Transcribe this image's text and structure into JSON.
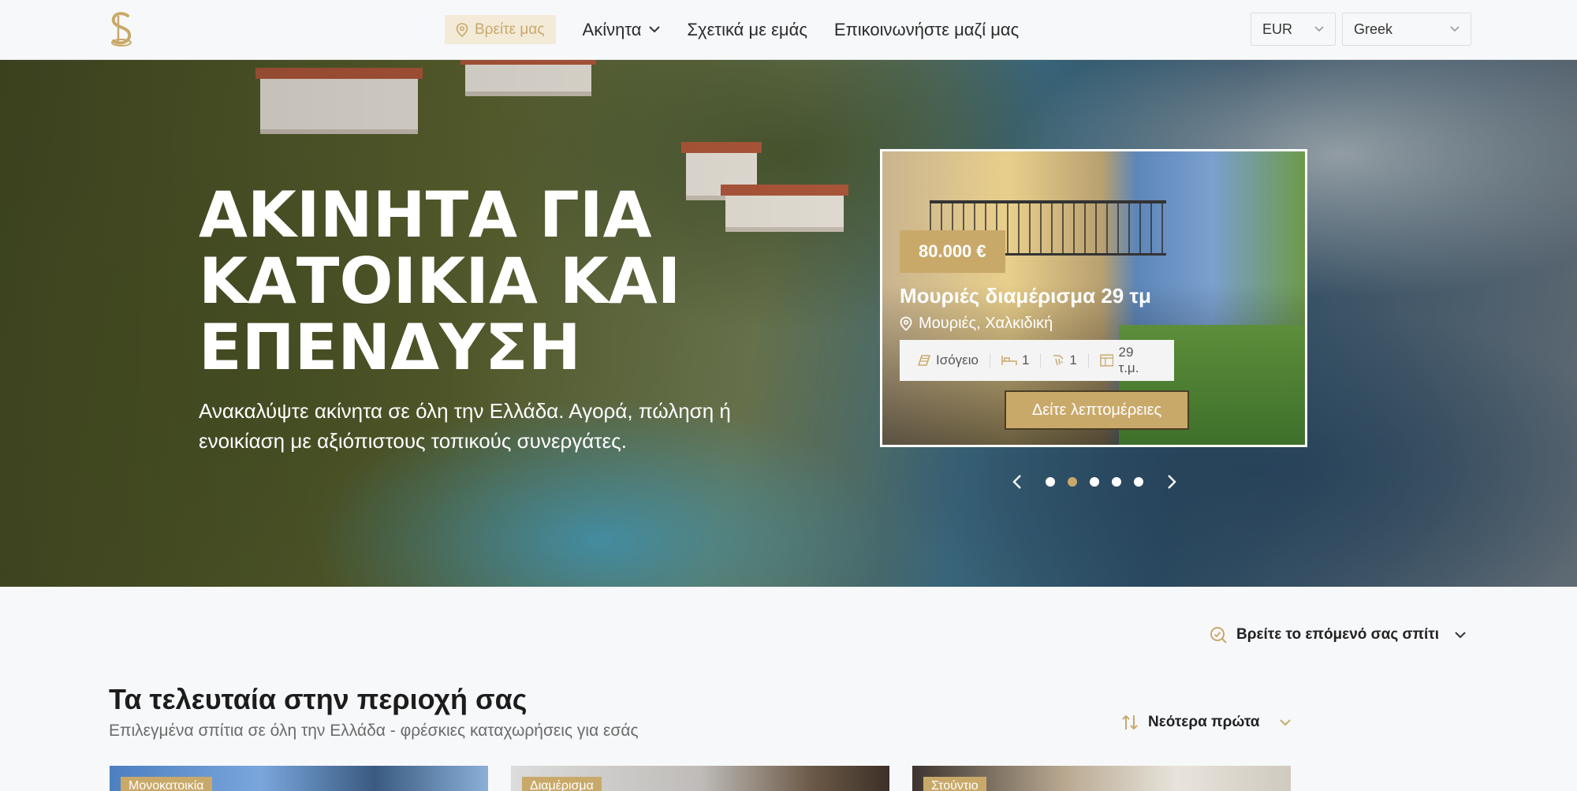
{
  "header": {
    "nav": {
      "find_us": "Βρείτε μας",
      "properties": "Ακίνητα",
      "about": "Σχετικά με εμάς",
      "contact": "Επικοινωνήστε μαζί μας"
    },
    "currency": "EUR",
    "language": "Greek"
  },
  "hero": {
    "title_line1": "ΑΚΙΝΗΤΑ ΓΙΑ",
    "title_line2": "ΚΑΤΟΙΚΙΑ ΚΑΙ",
    "title_line3": "ΕΠΕΝΔΥΣΗ",
    "subtitle_line1": "Ανακαλύψτε ακίνητα σε όλη την Ελλάδα. Αγορά, πώληση ή",
    "subtitle_line2": "ενοικίαση με αξιόπιστους τοπικούς συνεργάτες."
  },
  "featured": {
    "price": "80.000 €",
    "title": "Μουριές διαμέρισμα 29 τμ",
    "location": "Μουριές, Χαλκιδική",
    "floor": "Ισόγειο",
    "bedrooms": "1",
    "bathrooms": "1",
    "area": "29 τ.μ.",
    "details_button": "Δείτε λεπτομέρειες",
    "carousel_total": 5,
    "carousel_active": 2
  },
  "finder": {
    "label": "Βρείτε το επόμενό σας σπίτι"
  },
  "latest": {
    "title": "Τα τελευταία στην περιοχή σας",
    "subtitle": "Επιλεγμένα σπίτια σε όλη την Ελλάδα - φρέσκιες καταχωρήσεις για εσάς",
    "sort_label": "Νεότερα πρώτα",
    "cards": [
      {
        "tag": "Μονοκατοικία"
      },
      {
        "tag": "Διαμέρισμα"
      },
      {
        "tag": "Στούντιο"
      }
    ]
  },
  "colors": {
    "accent_gold": "#c9a96a",
    "find_us_bg": "#f3ead7",
    "page_bg": "#f7f8fa"
  }
}
